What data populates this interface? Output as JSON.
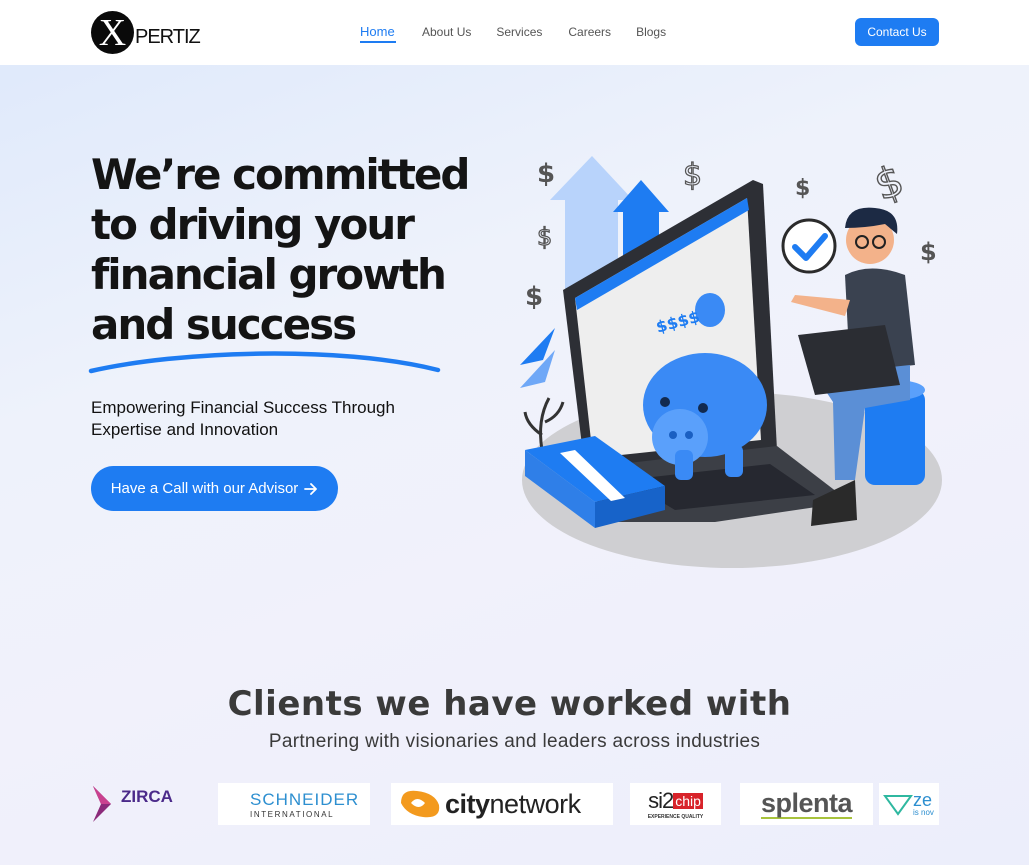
{
  "brand": {
    "logo_letter": "X",
    "logo_rest": "PERTIZ"
  },
  "nav": {
    "items": [
      {
        "label": "Home",
        "active": true
      },
      {
        "label": "About Us",
        "active": false
      },
      {
        "label": "Services",
        "active": false
      },
      {
        "label": "Careers",
        "active": false
      },
      {
        "label": "Blogs",
        "active": false
      }
    ],
    "contact_label": "Contact Us"
  },
  "hero": {
    "title_lines": [
      "We’re committed",
      "to driving your",
      "financial growth",
      "and success"
    ],
    "subtitle_lines": [
      "Empowering Financial Success Through",
      "Expertise and Innovation"
    ],
    "cta_label": "Have a Call with our Advisor",
    "cta_icon": "arrow-right-icon",
    "illustration_text": "$$$$"
  },
  "clients": {
    "title": "Clients we have worked with",
    "subtitle": "Partnering with visionaries and leaders across industries",
    "logos": [
      {
        "name": "ZIRCA"
      },
      {
        "name": "SCHNEIDER",
        "sub": "INTERNATIONAL"
      },
      {
        "name_a": "city",
        "name_b": "network"
      },
      {
        "name_a": "si2",
        "name_b": "chip",
        "sub": "EXPERIENCE QUALITY"
      },
      {
        "name": "splenta"
      },
      {
        "name": "ze",
        "sub": "is nov"
      }
    ]
  },
  "colors": {
    "accent": "#1e7cf2",
    "text": "#141414",
    "heading_gray": "#3a3a3a"
  }
}
